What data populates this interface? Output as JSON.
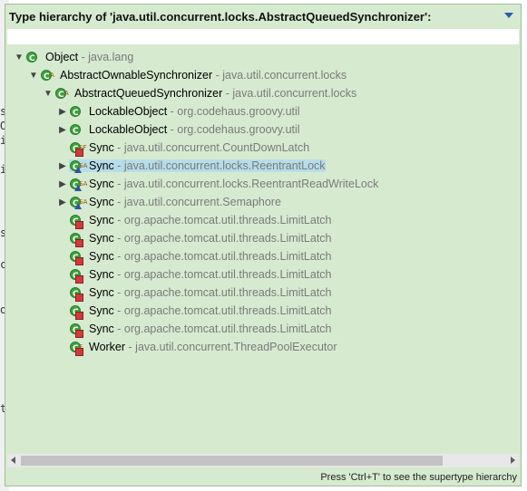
{
  "title": "Type hierarchy of 'java.util.concurrent.locks.AbstractQueuedSynchronizer':",
  "filter_value": "",
  "status_hint": "Press 'Ctrl+T' to see the supertype hierarchy",
  "editor_fragments": [
    "s",
    "O",
    "i",
    "i",
    "s",
    "c",
    "o",
    "t"
  ],
  "tree": [
    {
      "name": "Object",
      "pkg": "- java.lang",
      "depth": 0,
      "expanded": true,
      "twisty": "open",
      "icon": "class-icon",
      "sup": ""
    },
    {
      "name": "AbstractOwnableSynchronizer",
      "pkg": "- java.util.concurrent.locks",
      "depth": 1,
      "expanded": true,
      "twisty": "open",
      "icon": "abstract-class-icon",
      "sup": "A"
    },
    {
      "name": "AbstractQueuedSynchronizer",
      "pkg": "- java.util.concurrent.locks",
      "depth": 2,
      "expanded": true,
      "twisty": "open",
      "icon": "abstract-class-icon",
      "sup": "A"
    },
    {
      "name": "LockableObject",
      "pkg": "- org.codehaus.groovy.util",
      "depth": 3,
      "twisty": "closed",
      "icon": "class-icon",
      "sup": ""
    },
    {
      "name": "LockableObject",
      "pkg": "- org.codehaus.groovy.util",
      "depth": 3,
      "twisty": "closed",
      "icon": "class-icon",
      "sup": ""
    },
    {
      "name": "Sync",
      "pkg": "- java.util.concurrent.CountDownLatch",
      "depth": 3,
      "twisty": "none",
      "icon": "private-static-final-class-icon",
      "sup": "SF"
    },
    {
      "name": "Sync",
      "pkg": "- java.util.concurrent.locks.ReentrantLock",
      "depth": 3,
      "twisty": "closed",
      "icon": "abstract-static-class-icon",
      "sup": "SA",
      "selected": true
    },
    {
      "name": "Sync",
      "pkg": "- java.util.concurrent.locks.ReentrantReadWriteLock",
      "depth": 3,
      "twisty": "closed",
      "icon": "abstract-static-class-icon",
      "sup": "SA"
    },
    {
      "name": "Sync",
      "pkg": "- java.util.concurrent.Semaphore",
      "depth": 3,
      "twisty": "closed",
      "icon": "abstract-static-class-icon",
      "sup": "SA"
    },
    {
      "name": "Sync",
      "pkg": "- org.apache.tomcat.util.threads.LimitLatch",
      "depth": 3,
      "twisty": "none",
      "icon": "private-class-icon",
      "sup": ""
    },
    {
      "name": "Sync",
      "pkg": "- org.apache.tomcat.util.threads.LimitLatch",
      "depth": 3,
      "twisty": "none",
      "icon": "private-class-icon",
      "sup": ""
    },
    {
      "name": "Sync",
      "pkg": "- org.apache.tomcat.util.threads.LimitLatch",
      "depth": 3,
      "twisty": "none",
      "icon": "private-class-icon",
      "sup": ""
    },
    {
      "name": "Sync",
      "pkg": "- org.apache.tomcat.util.threads.LimitLatch",
      "depth": 3,
      "twisty": "none",
      "icon": "private-class-icon",
      "sup": ""
    },
    {
      "name": "Sync",
      "pkg": "- org.apache.tomcat.util.threads.LimitLatch",
      "depth": 3,
      "twisty": "none",
      "icon": "private-class-icon",
      "sup": ""
    },
    {
      "name": "Sync",
      "pkg": "- org.apache.tomcat.util.threads.LimitLatch",
      "depth": 3,
      "twisty": "none",
      "icon": "private-class-icon",
      "sup": ""
    },
    {
      "name": "Sync",
      "pkg": "- org.apache.tomcat.util.threads.LimitLatch",
      "depth": 3,
      "twisty": "none",
      "icon": "private-class-icon",
      "sup": ""
    },
    {
      "name": "Worker",
      "pkg": "- java.util.concurrent.ThreadPoolExecutor",
      "depth": 3,
      "twisty": "none",
      "icon": "private-final-class-icon",
      "sup": "F"
    }
  ]
}
